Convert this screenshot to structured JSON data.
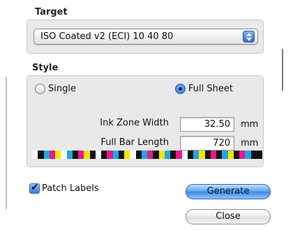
{
  "target": {
    "label": "Target",
    "selected": "ISO Coated v2 (ECI) 10 40 80"
  },
  "style": {
    "label": "Style",
    "options": [
      {
        "label": "Single",
        "selected": false
      },
      {
        "label": "Full Sheet",
        "selected": true
      }
    ],
    "fields": [
      {
        "label": "Ink Zone Width",
        "value": "32.50",
        "unit": "mm"
      },
      {
        "label": "Full Bar Length",
        "value": "720",
        "unit": "mm"
      }
    ],
    "color_bar": [
      "#ffffff",
      "#111111",
      "#1aa8e6",
      "#e8178a",
      "#f5e400",
      "#ffffff",
      "#1aa8e6",
      "#111111",
      "#e8178a",
      "#f5e400",
      "#111111",
      "#ffffff",
      "#111111",
      "#e8178a",
      "#1aa8e6",
      "#111111",
      "#f5e400",
      "#ffffff",
      "#111111",
      "#1aa8e6",
      "#e8178a",
      "#111111",
      "#f5e400",
      "#1aa8e6",
      "#111111",
      "#e8178a",
      "#ffffff",
      "#111111",
      "#1aa8e6",
      "#f5e400",
      "#111111",
      "#e8178a",
      "#111111",
      "#1aa8e6",
      "#f5e400",
      "#111111",
      "#e8178a",
      "#1aa8e6",
      "#111111",
      "#111111"
    ]
  },
  "patch_labels": {
    "label": "Patch Labels",
    "checked": true
  },
  "buttons": {
    "generate": "Generate",
    "close": "Close"
  },
  "colors": {
    "accent": "#3f86e0"
  }
}
